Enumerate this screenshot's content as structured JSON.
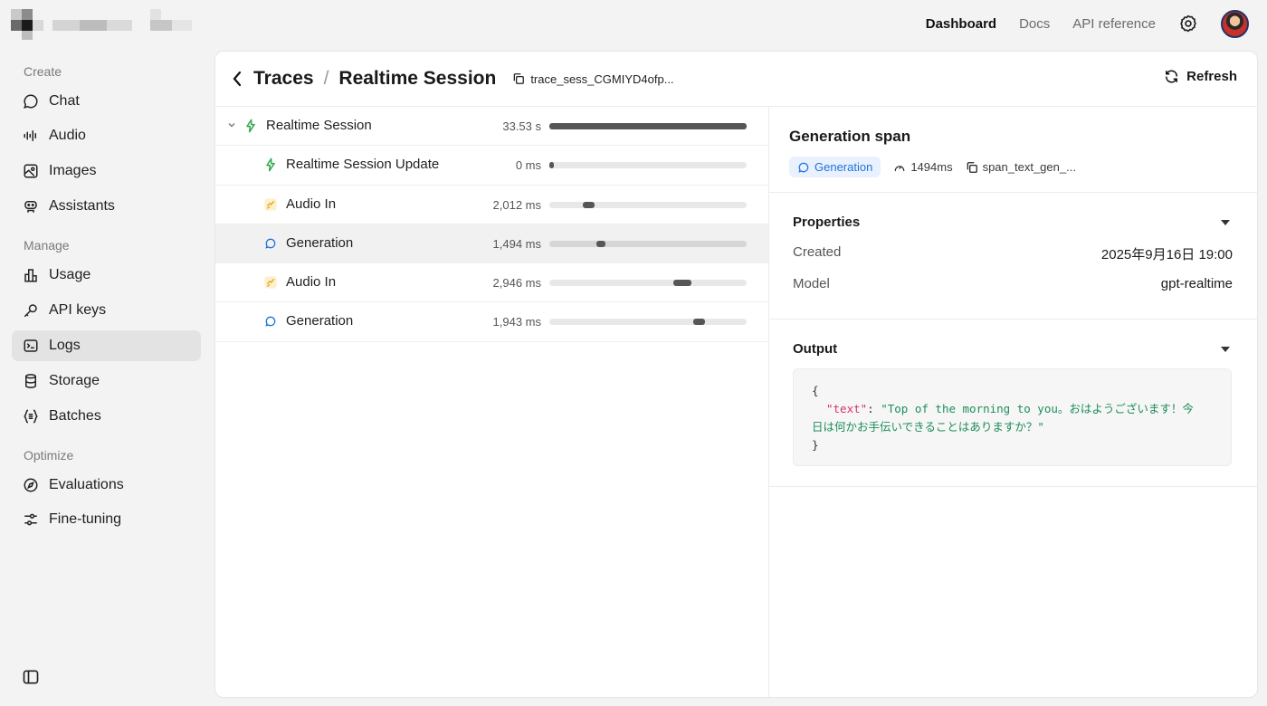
{
  "topnav": {
    "items": [
      {
        "label": "Dashboard",
        "active": true
      },
      {
        "label": "Docs",
        "active": false
      },
      {
        "label": "API reference",
        "active": false
      }
    ]
  },
  "sidebar": {
    "sections": [
      {
        "label": "Create"
      },
      {
        "label": "Manage"
      },
      {
        "label": "Optimize"
      }
    ],
    "items": [
      {
        "label": "Chat",
        "icon": "chat-icon"
      },
      {
        "label": "Audio",
        "icon": "audio-icon"
      },
      {
        "label": "Images",
        "icon": "image-icon"
      },
      {
        "label": "Assistants",
        "icon": "robot-icon"
      },
      {
        "label": "Usage",
        "icon": "chart-icon"
      },
      {
        "label": "API keys",
        "icon": "key-icon"
      },
      {
        "label": "Logs",
        "icon": "terminal-icon",
        "active": true
      },
      {
        "label": "Storage",
        "icon": "database-icon"
      },
      {
        "label": "Batches",
        "icon": "batch-icon"
      },
      {
        "label": "Evaluations",
        "icon": "compass-icon"
      },
      {
        "label": "Fine-tuning",
        "icon": "sliders-icon"
      }
    ]
  },
  "header": {
    "crumb1": "Traces",
    "separator": "/",
    "crumb2": "Realtime Session",
    "trace_id": "trace_sess_CGMIYD4ofp...",
    "refresh_label": "Refresh"
  },
  "spans": [
    {
      "name": "Realtime Session",
      "duration": "33.53 s",
      "type": "session",
      "bar_start": 0.0,
      "bar_fraction": 1.0,
      "selected": false
    },
    {
      "name": "Realtime Session Update",
      "duration": "0 ms",
      "type": "session",
      "bar_start": 0.0,
      "bar_fraction": 0.02,
      "selected": false
    },
    {
      "name": "Audio In",
      "duration": "2,012 ms",
      "type": "audio",
      "bar_start": 0.17,
      "bar_fraction": 0.06,
      "selected": false
    },
    {
      "name": "Generation",
      "duration": "1,494 ms",
      "type": "generation",
      "bar_start": 0.24,
      "bar_fraction": 0.045,
      "selected": true
    },
    {
      "name": "Audio In",
      "duration": "2,946 ms",
      "type": "audio",
      "bar_start": 0.63,
      "bar_fraction": 0.088,
      "selected": false
    },
    {
      "name": "Generation",
      "duration": "1,943 ms",
      "type": "generation",
      "bar_start": 0.73,
      "bar_fraction": 0.058,
      "selected": false
    }
  ],
  "detail": {
    "title": "Generation span",
    "badge": "Generation",
    "latency": "1494ms",
    "span_id": "span_text_gen_...",
    "properties_label": "Properties",
    "properties": [
      {
        "label": "Created",
        "value": "2025年9月16日 19:00"
      },
      {
        "label": "Model",
        "value": "gpt-realtime"
      }
    ],
    "output_label": "Output",
    "output": {
      "open": "{",
      "key": "\"text\"",
      "colon": ": ",
      "value_line1": "\"Top of the morning to you。おはようございます！今",
      "value_line2": "日は何かお手伝いできることはありますか？\"",
      "close": "}"
    }
  },
  "colors": {
    "accent_blue": "#1f74dc",
    "session_green": "#2fa84f",
    "audio_yellow": "#e8a317",
    "selected_row": "#f1f1f1"
  }
}
